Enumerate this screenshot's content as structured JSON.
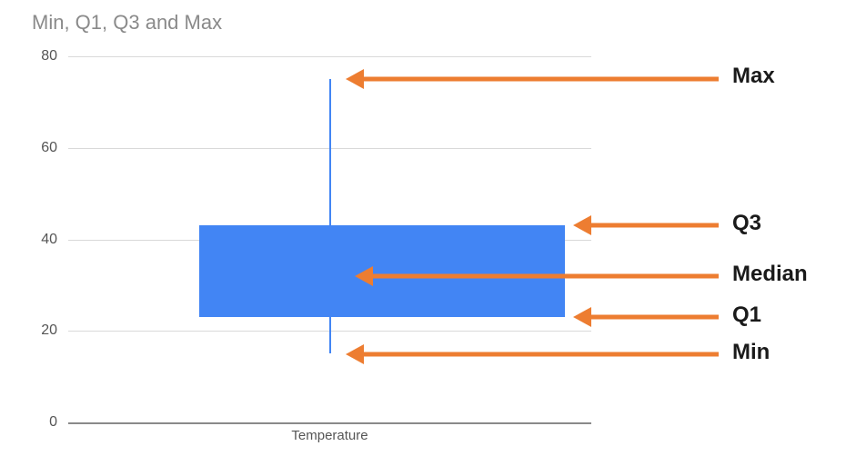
{
  "title": "Min, Q1, Q3 and Max",
  "x_axis_label": "Temperature",
  "y_ticks": {
    "t0": "0",
    "t20": "20",
    "t40": "40",
    "t60": "60",
    "t80": "80"
  },
  "annotations": {
    "max": "Max",
    "q3": "Q3",
    "median": "Median",
    "q1": "Q1",
    "min": "Min"
  },
  "chart_data": {
    "type": "boxplot",
    "title": "Min, Q1, Q3 and Max",
    "xlabel": "Temperature",
    "ylabel": "",
    "ylim": [
      0,
      80
    ],
    "categories": [
      "Temperature"
    ],
    "series": [
      {
        "name": "Temperature",
        "min": 15,
        "q1": 23,
        "median": 32,
        "q3": 43,
        "max": 75
      }
    ],
    "annotations": [
      "Max",
      "Q3",
      "Median",
      "Q1",
      "Min"
    ]
  }
}
